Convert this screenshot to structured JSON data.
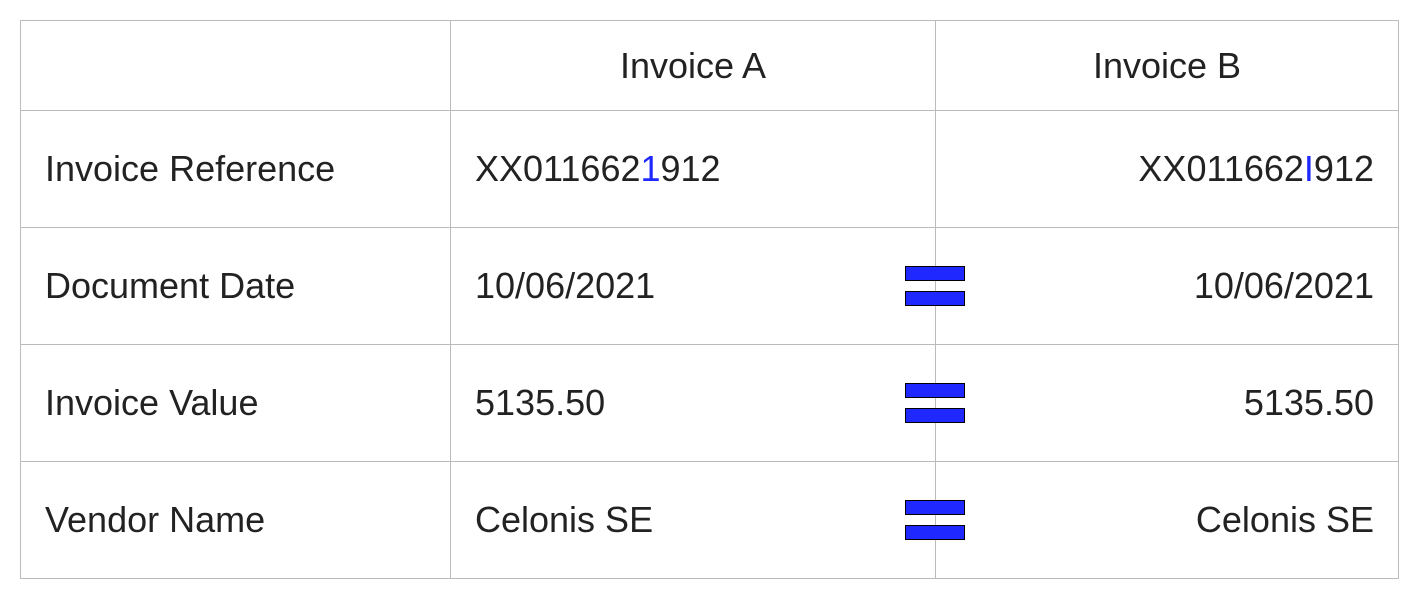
{
  "headers": {
    "col_empty": "",
    "col_a": "Invoice A",
    "col_b": "Invoice B"
  },
  "rows": [
    {
      "label": "Invoice Reference",
      "value_a_pre": "XX011662",
      "value_a_hl": "1",
      "value_a_post": "912",
      "show_equals": false,
      "value_b_pre": "XX011662",
      "value_b_hl": "I",
      "value_b_post": "912"
    },
    {
      "label": "Document Date",
      "value_a_pre": "10/06/2021",
      "value_a_hl": "",
      "value_a_post": "",
      "show_equals": true,
      "value_b_pre": "10/06/2021",
      "value_b_hl": "",
      "value_b_post": ""
    },
    {
      "label": "Invoice Value",
      "value_a_pre": "5135.50",
      "value_a_hl": "",
      "value_a_post": "",
      "show_equals": true,
      "value_b_pre": "5135.50",
      "value_b_hl": "",
      "value_b_post": ""
    },
    {
      "label": "Vendor Name",
      "value_a_pre": "Celonis SE",
      "value_a_hl": "",
      "value_a_post": "",
      "show_equals": true,
      "value_b_pre": "Celonis SE",
      "value_b_hl": "",
      "value_b_post": ""
    }
  ]
}
